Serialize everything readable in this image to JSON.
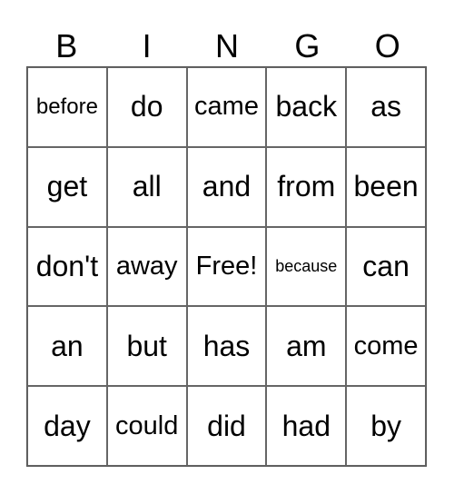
{
  "header": {
    "letters": [
      "B",
      "I",
      "N",
      "G",
      "O"
    ]
  },
  "card": {
    "rows": [
      [
        "before",
        "do",
        "came",
        "back",
        "as"
      ],
      [
        "get",
        "all",
        "and",
        "from",
        "been"
      ],
      [
        "don't",
        "away",
        "Free!",
        "because",
        "can"
      ],
      [
        "an",
        "but",
        "has",
        "am",
        "come"
      ],
      [
        "day",
        "could",
        "did",
        "had",
        "by"
      ]
    ]
  }
}
